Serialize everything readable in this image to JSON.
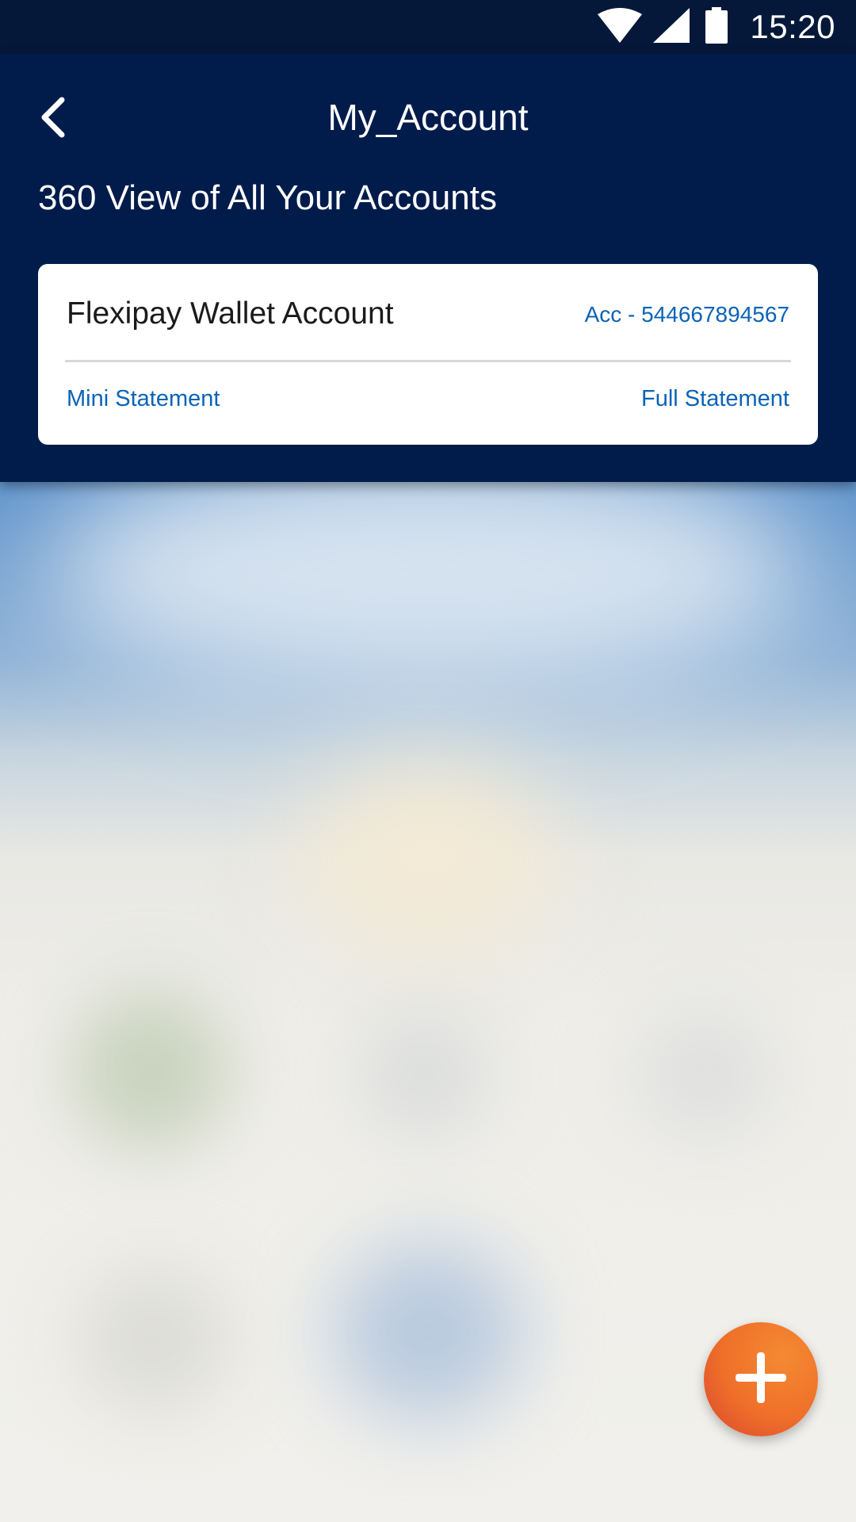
{
  "status_bar": {
    "time": "15:20",
    "icons": [
      "wifi-icon",
      "cell-signal-icon",
      "battery-icon"
    ]
  },
  "header": {
    "back_icon": "chevron-left-icon",
    "title": "My_Account",
    "subtitle": "360 View of All Your Accounts"
  },
  "account_card": {
    "name": "Flexipay Wallet Account",
    "account_prefix": "Acc - ",
    "account_number": "544667894567",
    "mini_statement_label": "Mini Statement",
    "full_statement_label": "Full Statement"
  },
  "fab": {
    "icon": "plus-icon"
  },
  "colors": {
    "header_bg": "#011c4b",
    "status_bar_bg": "#061839",
    "link_blue": "#0b63b6",
    "fab_orange": "#ef6f2a"
  }
}
